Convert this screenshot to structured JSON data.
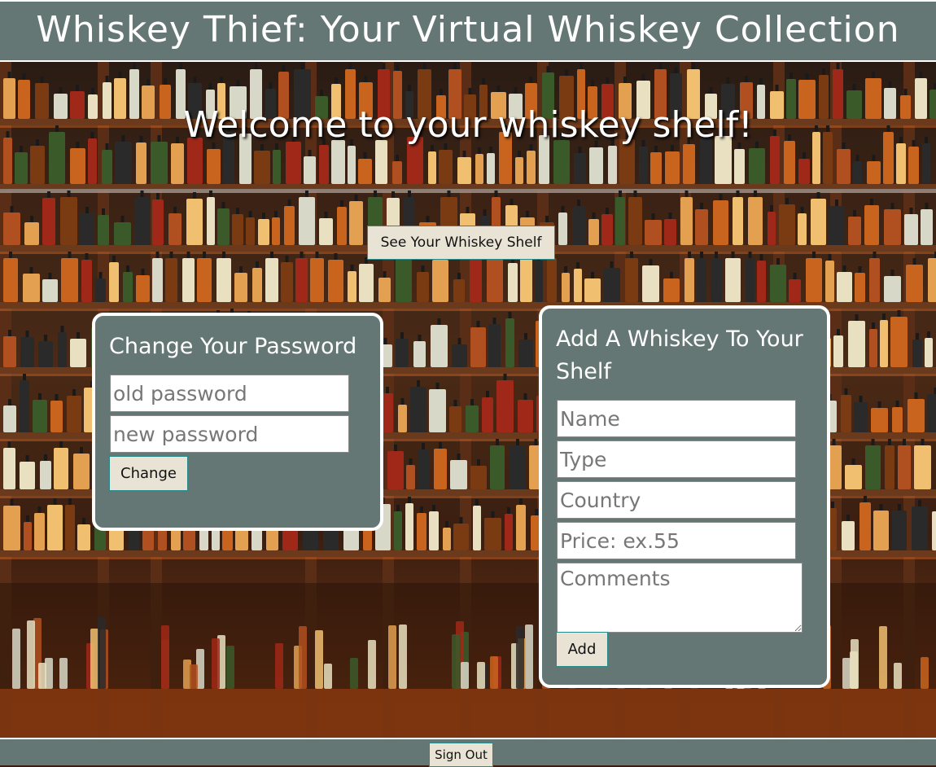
{
  "header": {
    "title": "Whiskey Thief: Your Virtual Whiskey Collection"
  },
  "main": {
    "welcome": "Welcome to your whiskey shelf!",
    "see_shelf_label": "See Your Whiskey Shelf"
  },
  "password_panel": {
    "title": "Change Your Password",
    "old_placeholder": "old password",
    "new_placeholder": "new password",
    "change_label": "Change"
  },
  "add_panel": {
    "title": "Add A Whiskey To Your Shelf",
    "name_placeholder": "Name",
    "type_placeholder": "Type",
    "country_placeholder": "Country",
    "price_placeholder": "Price: ex.55",
    "comments_placeholder": "Comments",
    "add_label": "Add"
  },
  "footer": {
    "signout_label": "Sign Out"
  },
  "colors": {
    "panel": "#647774",
    "button": "#e8e3d4",
    "accent_border": "#2a8a8a"
  }
}
